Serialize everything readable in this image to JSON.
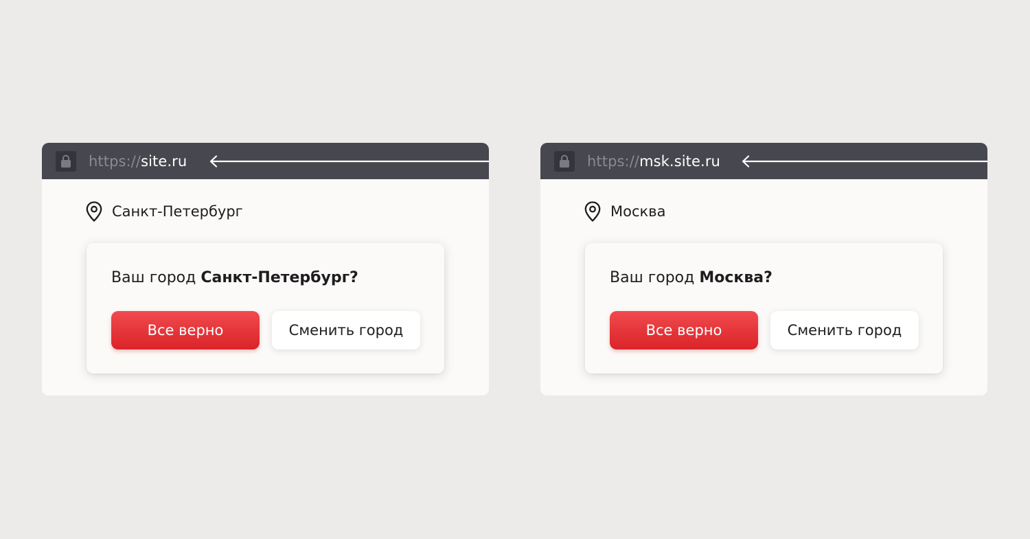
{
  "colors": {
    "background": "#ECEBE9",
    "window": "#FBFAF8",
    "address_bar": "#47474F",
    "accent_red": "#E53236",
    "url_scheme": "#8A8A92",
    "url_host": "#FFFFFF"
  },
  "icons": {
    "lock": "lock-icon",
    "arrow": "arrow-left-icon",
    "location": "location-pin-icon"
  },
  "windows": [
    {
      "url_scheme": "https://",
      "url_host": "site.ru",
      "location_label": "Санкт-Петербург",
      "popup": {
        "question_prefix": "Ваш город ",
        "question_city": "Санкт-Петербург?",
        "confirm_label": "Все верно",
        "change_label": "Сменить город"
      }
    },
    {
      "url_scheme": "https://",
      "url_host": "msk.site.ru",
      "location_label": "Москва",
      "popup": {
        "question_prefix": "Ваш город ",
        "question_city": "Москва?",
        "confirm_label": "Все верно",
        "change_label": "Сменить город"
      }
    }
  ]
}
